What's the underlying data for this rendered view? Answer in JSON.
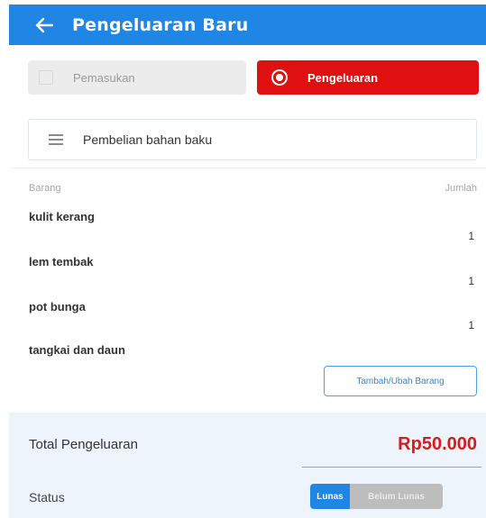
{
  "header": {
    "title": "Pengeluaran Baru",
    "back_icon": "arrow-left-icon"
  },
  "type_toggle": {
    "income_label": "Pemasukan",
    "expense_label": "Pengeluaran",
    "selected": "Pengeluaran"
  },
  "note": {
    "value": "Pembelian bahan baku",
    "icon": "menu-lines-icon"
  },
  "items": {
    "col_item": "Barang",
    "col_qty": "Jumlah",
    "rows": [
      {
        "name": "kulit kerang",
        "qty": "1"
      },
      {
        "name": "lem tembak",
        "qty": "1"
      },
      {
        "name": "pot bunga",
        "qty": "1"
      },
      {
        "name": "tangkai dan daun",
        "qty": ""
      }
    ],
    "edit_button": "Tambah/Ubah Barang"
  },
  "summary": {
    "total_label": "Total Pengeluaran",
    "total_value": "Rp50.000",
    "status_label": "Status",
    "status_options": [
      "Lunas",
      "Belum Lunas"
    ],
    "status_selected": "Lunas"
  },
  "colors": {
    "primary": "#1f86e6",
    "expense": "#e01010",
    "total": "#d81b1b"
  }
}
